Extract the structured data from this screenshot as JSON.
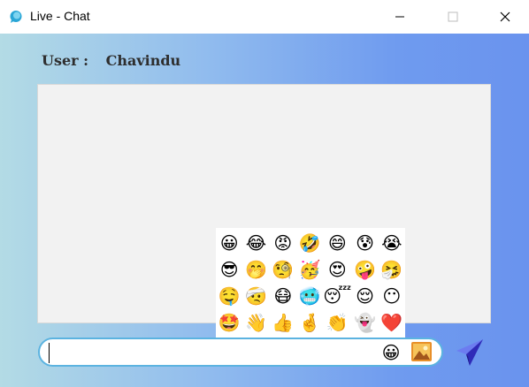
{
  "window": {
    "title": "Live - Chat",
    "icon": "chat-bubble-icon",
    "controls": [
      "minimize-icon",
      "maximize-icon",
      "close-icon"
    ]
  },
  "header": {
    "user_label": "User :",
    "user_name": "Chavindu"
  },
  "emoji_picker": {
    "emojis": [
      "😀",
      "😂",
      "😡",
      "🤣",
      "😄",
      "😰",
      "😭",
      "😎",
      "🤭",
      "🧐",
      "🥳",
      "😍",
      "🤪",
      "🤧",
      "🤤",
      "🤕",
      "😷",
      "🥶",
      "😴",
      "😌",
      "😶",
      "🤩",
      "👋",
      "👍",
      "🤞",
      "👏",
      "👻",
      "❤️"
    ]
  },
  "composer": {
    "message_value": "",
    "emoji_button": "😀",
    "image_button_icon": "image-icon",
    "send_button_icon": "paper-plane-icon"
  },
  "colors": {
    "input_border": "#5bb3e0",
    "send_icon": "#3a36c9"
  }
}
